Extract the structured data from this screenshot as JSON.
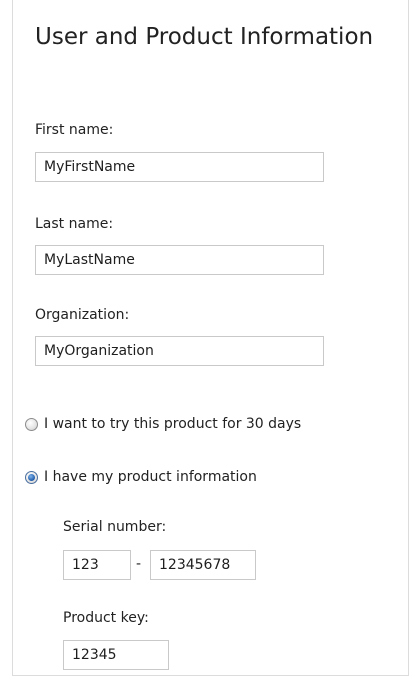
{
  "title": "User and Product Information",
  "first_name": {
    "label": "First name:",
    "value": "MyFirstName"
  },
  "last_name": {
    "label": "Last name:",
    "value": "MyLastName"
  },
  "organization": {
    "label": "Organization:",
    "value": "MyOrganization"
  },
  "options": {
    "trial_label": "I want to try this product for 30 days",
    "trial_selected": false,
    "have_info_label": "I have my product information",
    "have_info_selected": true
  },
  "serial_number": {
    "label": "Serial number:",
    "part1": "123",
    "separator": "-",
    "part2": "12345678"
  },
  "product_key": {
    "label": "Product key:",
    "value": "12345"
  }
}
